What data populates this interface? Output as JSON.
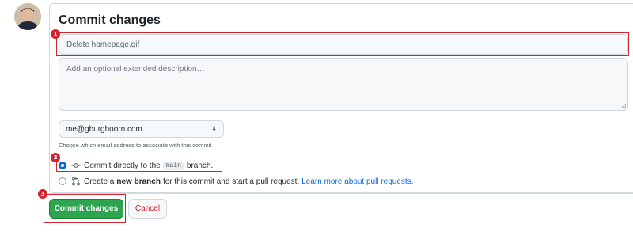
{
  "form": {
    "title": "Commit changes",
    "summary_value": "Delete homepage.gif",
    "description_placeholder": "Add an optional extended description…",
    "email_selected": "me@gburghoorn.com",
    "email_hint": "Choose which email address to associate with this commit"
  },
  "options": {
    "direct": {
      "selected": true,
      "prefix": "Commit directly to the",
      "branch": "main",
      "suffix": "branch."
    },
    "new_branch": {
      "selected": false,
      "prefix": "Create a",
      "bold": "new branch",
      "suffix": "for this commit and start a pull request.",
      "link": "Learn more about pull requests."
    }
  },
  "buttons": {
    "commit_label": "Commit changes",
    "cancel_label": "Cancel"
  },
  "annotations": [
    "1",
    "2",
    "3"
  ],
  "colors": {
    "primary": "#2da44e",
    "danger": "#cf222e",
    "link": "#0969da",
    "highlight": "#d1242f"
  },
  "icons": {
    "avatar": "user-avatar",
    "commit": "git-commit-icon",
    "branch": "git-pull-request-icon",
    "select": "updown-icon"
  }
}
